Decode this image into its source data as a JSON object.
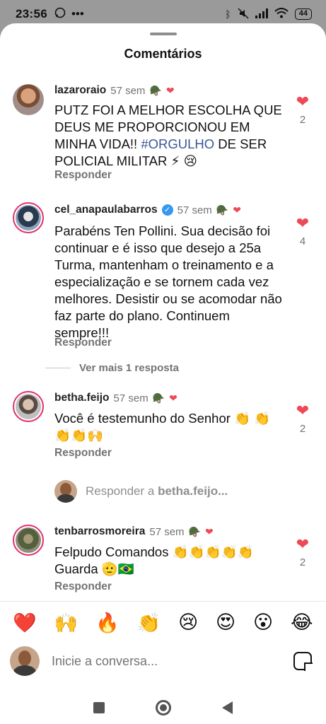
{
  "status": {
    "time": "23:56",
    "battery": "44",
    "left_icons": [
      "whatsapp-icon",
      "more-dots-icon"
    ],
    "right_icons": [
      "bluetooth-icon",
      "mute-icon",
      "signal-icon",
      "wifi-icon",
      "battery-icon"
    ]
  },
  "sheet": {
    "title": "Comentários"
  },
  "comments": [
    {
      "user": "lazaroraio",
      "age": "57 sem",
      "text_before": "PUTZ FOI A MELHOR ESCOLHA QUE DEUS ME PROPORCIONOU EM MINHA VIDA!! ",
      "tag": "#ORGULHO",
      "text_after": " DE SER POLICIAL MILITAR ⚡ 😢",
      "likes": "2",
      "reply": "Responder"
    },
    {
      "user": "cel_anapaulabarros",
      "age": "57 sem",
      "text": "Parabéns Ten Pollini. Sua decisão foi continuar e é isso  que desejo a 25a Turma, mantenham o treinamento e a especialização e se tornem cada vez melhores. Desistir ou se acomodar não faz parte do plano.  Continuem sempre!!!",
      "likes": "4",
      "reply": "Responder"
    },
    {
      "user": "betha.feijo",
      "age": "57 sem",
      "text": "Você é testemunho do Senhor 👏 👏👏👏🙌",
      "likes": "2",
      "reply": "Responder"
    },
    {
      "user": "tenbarrosmoreira",
      "age": "57 sem",
      "text": "Felpudo Comandos 👏👏👏👏👏 Guarda 🫡🇧🇷",
      "likes": "2",
      "reply": "Responder"
    }
  ],
  "view_more": "Ver mais 1 resposta",
  "reply_to": {
    "prefix": "Responder a ",
    "user": "betha.feijo..."
  },
  "emoji_bar": [
    "❤️",
    "🙌",
    "🔥",
    "👏",
    "😢",
    "😍",
    "😮",
    "😂"
  ],
  "input": {
    "placeholder": "Inicie a conversa..."
  },
  "colors": {
    "like": "#ed4956",
    "hashtag": "#385898",
    "verified": "#3897f0",
    "ring": "#e1306c"
  }
}
